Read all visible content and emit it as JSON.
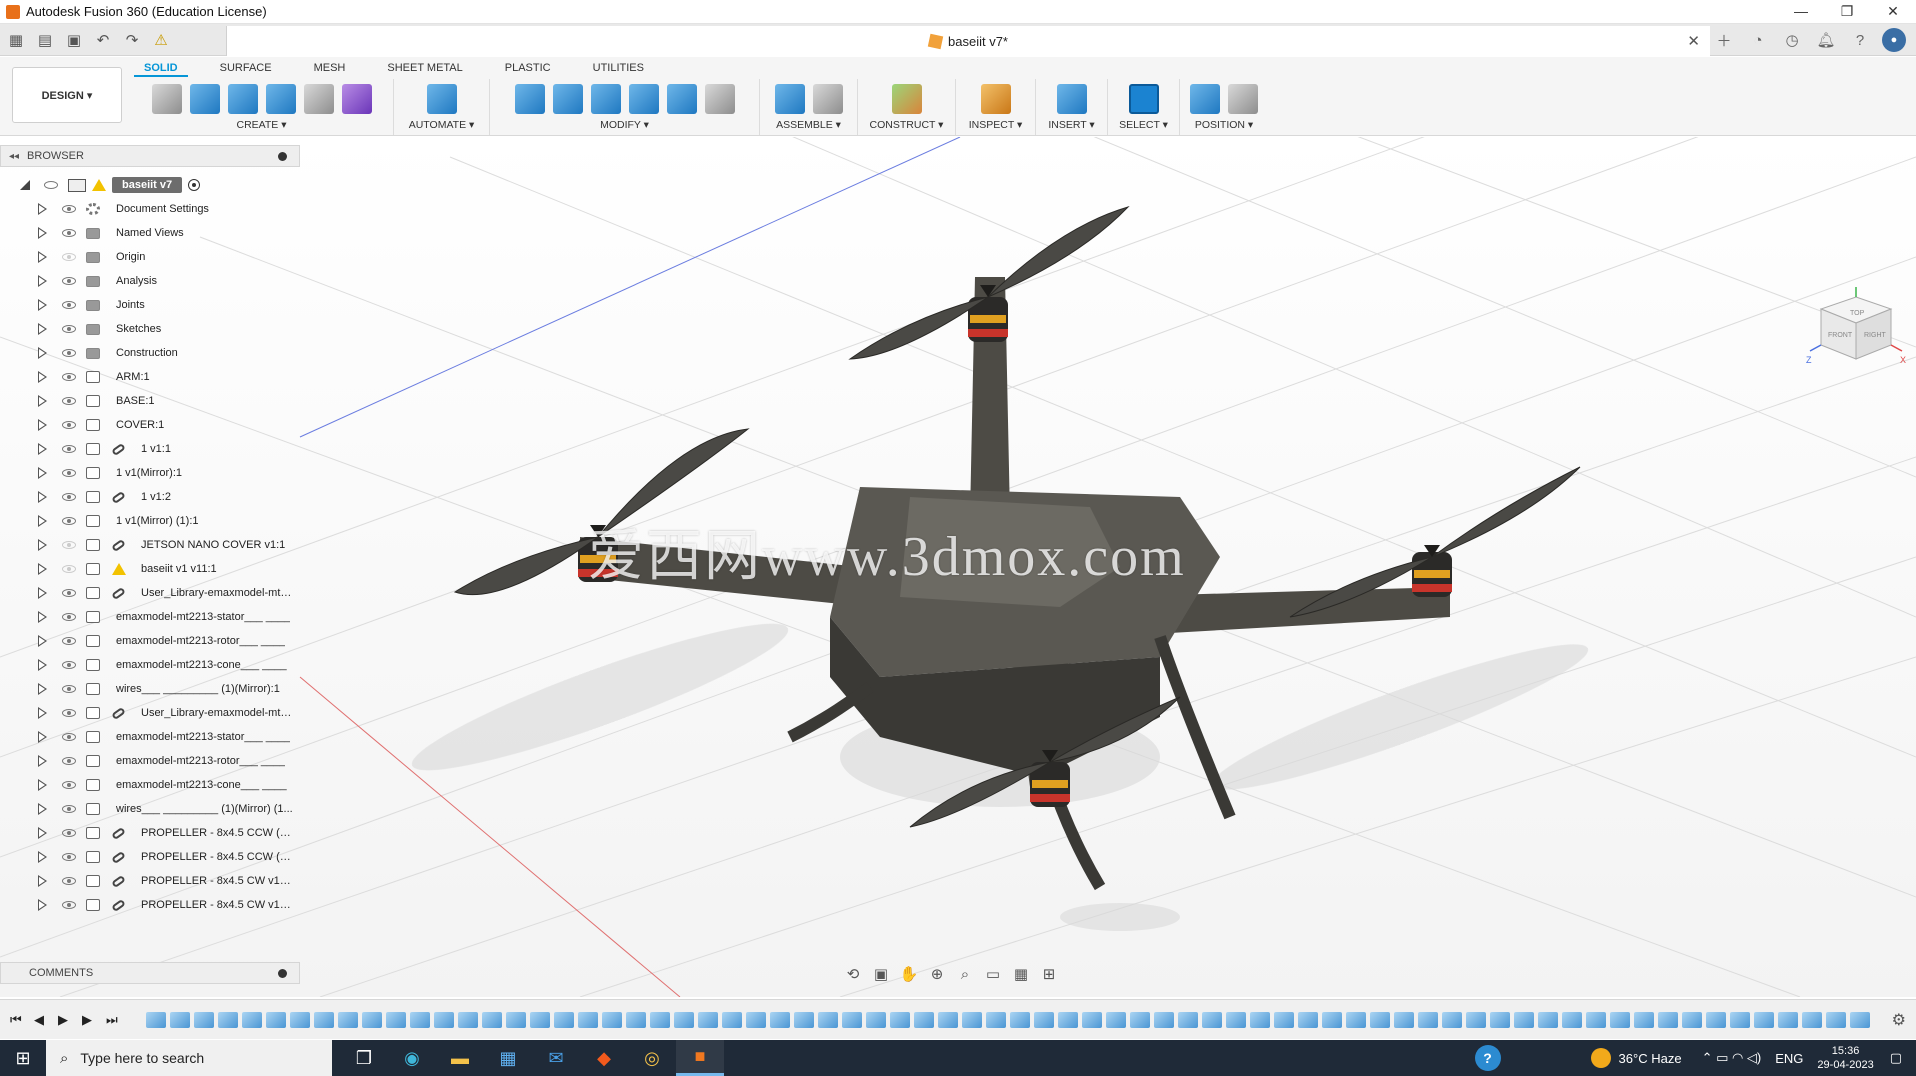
{
  "window": {
    "title": "Autodesk Fusion 360 (Education License)",
    "controls": [
      "—",
      "❐",
      "✕"
    ]
  },
  "document": {
    "tab_name": "baseiit v7*"
  },
  "quick_access": {
    "icons": [
      "apps-grid-icon",
      "file-icon",
      "save-icon",
      "undo-icon",
      "redo-icon",
      "warning-icon"
    ]
  },
  "header_right_icons": [
    "new-tab-icon",
    "extensions-icon",
    "job-status-icon",
    "notifications-icon",
    "help-icon",
    "user-avatar-icon"
  ],
  "ribbon": {
    "workspace": "DESIGN ▾",
    "tabs": [
      {
        "label": "SOLID",
        "active": true
      },
      {
        "label": "SURFACE"
      },
      {
        "label": "MESH"
      },
      {
        "label": "SHEET METAL"
      },
      {
        "label": "PLASTIC"
      },
      {
        "label": "UTILITIES"
      }
    ],
    "groups": [
      {
        "label": "CREATE ▾"
      },
      {
        "label": "AUTOMATE ▾"
      },
      {
        "label": "MODIFY ▾"
      },
      {
        "label": "ASSEMBLE ▾"
      },
      {
        "label": "CONSTRUCT ▾"
      },
      {
        "label": "INSPECT ▾"
      },
      {
        "label": "INSERT ▾"
      },
      {
        "label": "SELECT ▾"
      },
      {
        "label": "POSITION ▾"
      }
    ]
  },
  "browser": {
    "title": "BROWSER",
    "root": "baseiit v7",
    "items": [
      {
        "label": "Document Settings",
        "icon": "gear"
      },
      {
        "label": "Named Views",
        "icon": "folder"
      },
      {
        "label": "Origin",
        "icon": "folder",
        "hidden": true
      },
      {
        "label": "Analysis",
        "icon": "folder"
      },
      {
        "label": "Joints",
        "icon": "folder"
      },
      {
        "label": "Sketches",
        "icon": "folder"
      },
      {
        "label": "Construction",
        "icon": "folder"
      },
      {
        "label": "ARM:1",
        "icon": "component"
      },
      {
        "label": "BASE:1",
        "icon": "component"
      },
      {
        "label": "COVER:1",
        "icon": "component"
      },
      {
        "label": "1 v1:1",
        "icon": "component",
        "linked": true
      },
      {
        "label": "1 v1(Mirror):1",
        "icon": "component"
      },
      {
        "label": "1 v1:2",
        "icon": "component",
        "linked": true
      },
      {
        "label": "1 v1(Mirror) (1):1",
        "icon": "component"
      },
      {
        "label": "JETSON NANO COVER v1:1",
        "icon": "component",
        "linked": true,
        "hidden": true
      },
      {
        "label": "baseiit v1 v11:1",
        "icon": "component",
        "warning": true,
        "hidden": true
      },
      {
        "label": "User_Library-emaxmodel-mt2...",
        "icon": "component",
        "linked": true
      },
      {
        "label": "emaxmodel-mt2213-stator___ ____",
        "icon": "component"
      },
      {
        "label": "emaxmodel-mt2213-rotor___ ____",
        "icon": "component"
      },
      {
        "label": "emaxmodel-mt2213-cone___ ____",
        "icon": "component"
      },
      {
        "label": "wires___ _________ (1)(Mirror):1",
        "icon": "component"
      },
      {
        "label": "User_Library-emaxmodel-mt2...",
        "icon": "component",
        "linked": true
      },
      {
        "label": "emaxmodel-mt2213-stator___ ____",
        "icon": "component"
      },
      {
        "label": "emaxmodel-mt2213-rotor___ ____",
        "icon": "component"
      },
      {
        "label": "emaxmodel-mt2213-cone___ ____",
        "icon": "component"
      },
      {
        "label": "wires___ _________ (1)(Mirror) (1...",
        "icon": "component"
      },
      {
        "label": "PROPELLER - 8x4.5 CCW (1) ...",
        "icon": "component",
        "linked": true
      },
      {
        "label": "PROPELLER - 8x4.5 CCW (1) ...",
        "icon": "component",
        "linked": true
      },
      {
        "label": "PROPELLER - 8x4.5 CW v1 v'...",
        "icon": "component",
        "linked": true
      },
      {
        "label": "PROPELLER - 8x4.5 CW v1 v'...",
        "icon": "component",
        "linked": true
      }
    ]
  },
  "comments": {
    "title": "COMMENTS"
  },
  "viewcube": {
    "faces": [
      "TOP",
      "FRONT",
      "RIGHT"
    ],
    "axes": [
      "X",
      "Y",
      "Z"
    ]
  },
  "watermark": "爱西网www.3dmox.com",
  "timeline": {
    "controls": [
      "first-icon",
      "prev-icon",
      "play-icon",
      "next-icon",
      "last-icon"
    ],
    "feature_count": 72
  },
  "taskbar": {
    "search_placeholder": "Type here to search",
    "weather": "36°C  Haze",
    "language": "ENG",
    "time": "15:36",
    "date": "29-04-2023"
  }
}
